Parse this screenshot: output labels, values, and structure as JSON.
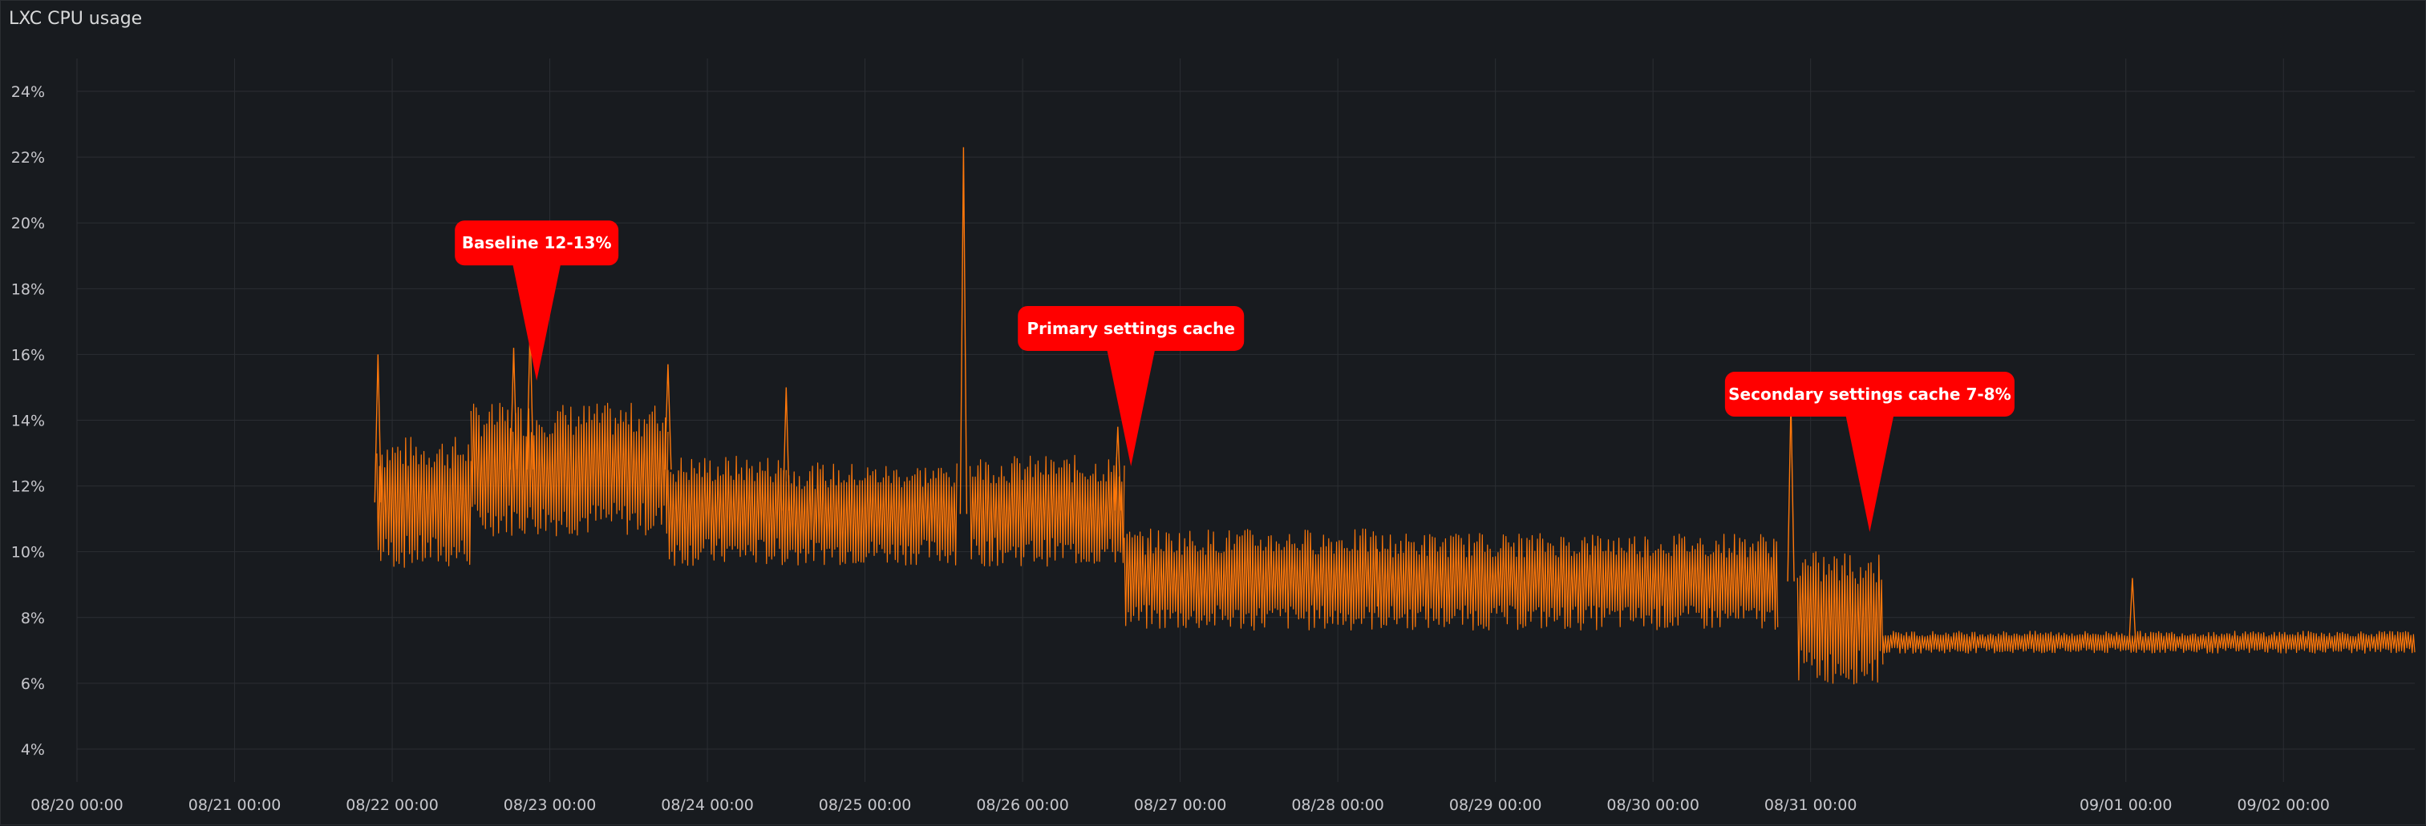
{
  "panel": {
    "title": "LXC CPU usage"
  },
  "chart_data": {
    "type": "line",
    "title": "LXC CPU usage",
    "ylim": [
      3.0,
      25.0
    ],
    "xlim": [
      "08/20 00:00",
      "09/02 20:00"
    ],
    "yticks": [
      "4%",
      "6%",
      "8%",
      "10%",
      "12%",
      "14%",
      "16%",
      "18%",
      "20%",
      "22%",
      "24%"
    ],
    "xticks": [
      "08/20 00:00",
      "08/21 00:00",
      "08/22 00:00",
      "08/23 00:00",
      "08/24 00:00",
      "08/25 00:00",
      "08/26 00:00",
      "08/27 00:00",
      "08/28 00:00",
      "08/29 00:00",
      "08/30 00:00",
      "08/31 00:00",
      "09/01 00:00",
      "09/02 00:00"
    ],
    "grid": true,
    "series": [
      {
        "color": "#ff780a",
        "segments": [
          {
            "start": "08/21 21:40",
            "end": "08/22 12:00",
            "low": 10.0,
            "high": 13.0
          },
          {
            "start": "08/22 12:00",
            "end": "08/23 18:00",
            "low": 11.0,
            "high": 14.0
          },
          {
            "start": "08/23 18:00",
            "end": "08/24 12:00",
            "low": 10.0,
            "high": 12.5
          },
          {
            "start": "08/24 12:00",
            "end": "08/25 14:00",
            "low": 10.0,
            "high": 12.3
          },
          {
            "start": "08/25 16:00",
            "end": "08/26 15:30",
            "low": 10.0,
            "high": 12.5
          },
          {
            "start": "08/26 15:30",
            "end": "08/28 06:00",
            "low": 8.0,
            "high": 10.3
          },
          {
            "start": "08/28 06:00",
            "end": "08/30 19:00",
            "low": 8.0,
            "high": 10.2
          },
          {
            "start": "08/30 22:00",
            "end": "08/31 11:00",
            "low": 6.5,
            "high": 9.5
          },
          {
            "start": "08/31 11:00",
            "end": "09/02 20:00",
            "low": 7.0,
            "high": 7.5
          }
        ],
        "spikes": [
          {
            "at": "08/21 21:50",
            "value": 16.0
          },
          {
            "at": "08/22 18:30",
            "value": 16.2
          },
          {
            "at": "08/22 21:00",
            "value": 16.9
          },
          {
            "at": "08/23 18:00",
            "value": 15.7
          },
          {
            "at": "08/24 12:00",
            "value": 15.0
          },
          {
            "at": "08/25 15:00",
            "value": 22.3
          },
          {
            "at": "08/26 14:30",
            "value": 13.8
          },
          {
            "at": "08/30 21:00",
            "value": 14.6
          },
          {
            "at": "09/01 01:00",
            "value": 9.2
          }
        ]
      }
    ],
    "annotations": [
      {
        "text": "Baseline 12-13%",
        "at": "08/22 22:00",
        "value": 15.2
      },
      {
        "text": "Primary settings cache",
        "at": "08/26 16:30",
        "value": 12.6
      },
      {
        "text": "Secondary settings cache 7-8%",
        "at": "08/31 09:00",
        "value": 10.6
      }
    ]
  }
}
